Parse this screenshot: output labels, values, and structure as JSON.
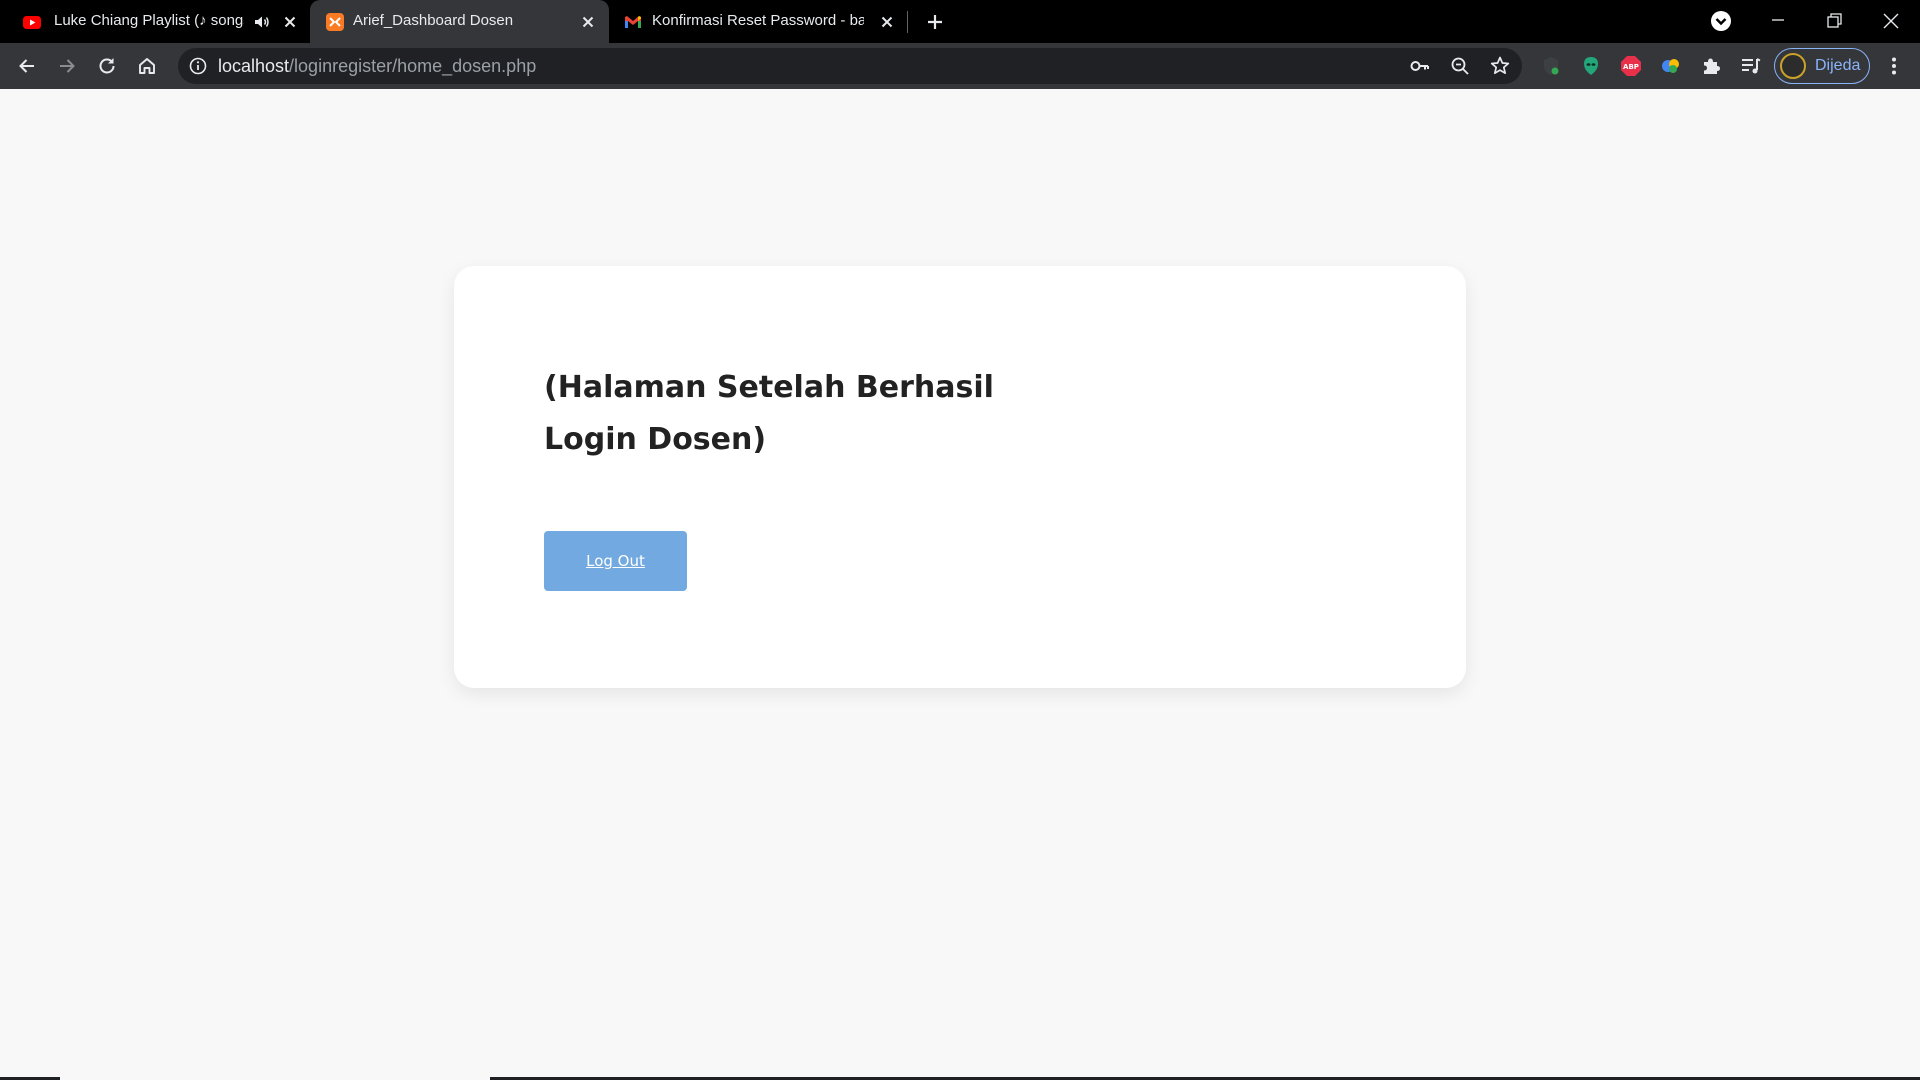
{
  "browser": {
    "tabs": [
      {
        "title": "Luke Chiang Playlist (♪ songs",
        "favicon": "youtube-icon",
        "audio_icon": "speaker-icon"
      },
      {
        "title": "Arief_Dashboard Dosen",
        "favicon": "xampp-icon",
        "active": true
      },
      {
        "title": "Konfirmasi Reset Password - baih",
        "favicon": "gmail-icon"
      }
    ],
    "address_bar": {
      "host": "localhost",
      "path": "/loginregister/home_dosen.php"
    },
    "profile": {
      "label": "Dijeda"
    },
    "colors": {
      "tabstrip": "#000000",
      "toolbar": "#35363a",
      "omnibox": "#202124",
      "accent": "#8ab4f8"
    }
  },
  "page": {
    "title": "(Halaman Setelah Berhasil Login Dosen)",
    "logout_button": "Log Out",
    "colors": {
      "background": "#f8f8f8",
      "card": "#ffffff",
      "button": "#71a9e0"
    }
  }
}
